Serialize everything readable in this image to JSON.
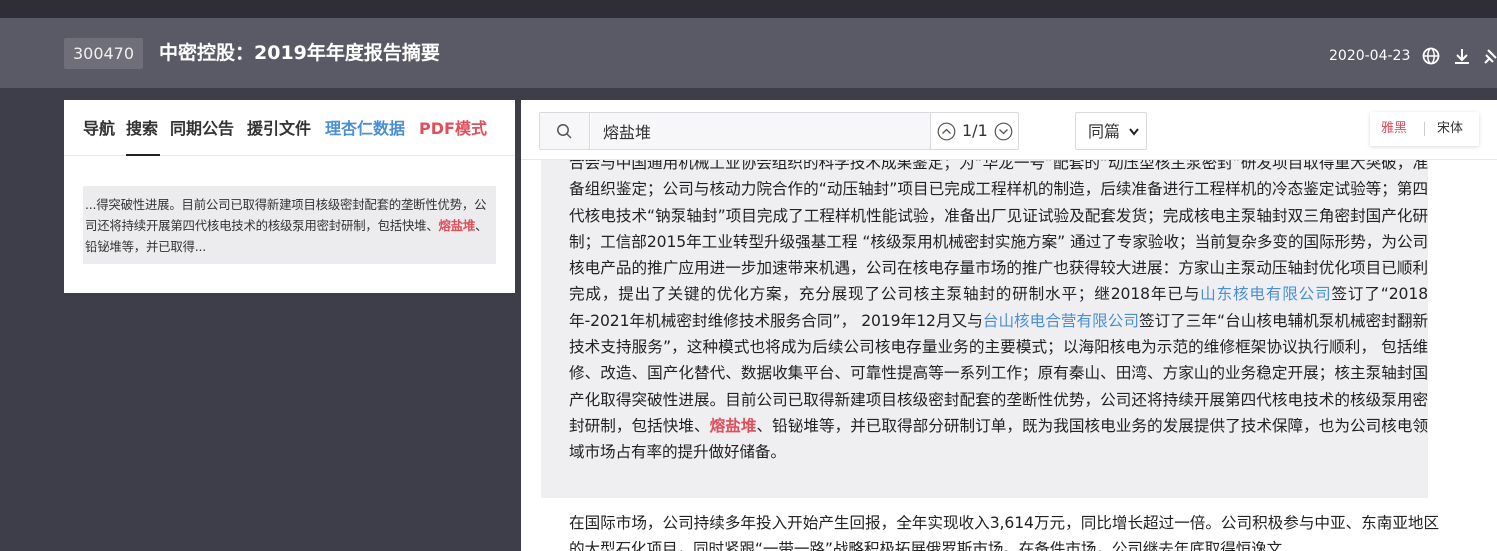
{
  "header": {
    "stock_code": "300470",
    "title": "中密控股：2019年年度报告摘要",
    "date": "2020-04-23",
    "icons": [
      "globe-icon",
      "download-icon",
      "pin-icon"
    ]
  },
  "nav": {
    "items": [
      "导航",
      "搜索",
      "同期公告",
      "援引文件",
      "理杏仁数据",
      "PDF模式"
    ],
    "active": "搜索",
    "colors": {
      "default": "#333333",
      "lixinger": "#4a8fd6",
      "pdf": "#e04f5c"
    }
  },
  "search_result": {
    "before": "...得突破性进展。目前公司已取得新建项目核级密封配套的垄断性优势，公司还将持续开展第四代核电技术的核级泵用密封研制，包括快堆、",
    "match": "熔盐堆",
    "after": "、铅铋堆等，并已取得..."
  },
  "toolbar": {
    "search_value": "熔盐堆",
    "match_count": "1/1",
    "scope": "同篇",
    "font_options": [
      "雅黑",
      "宋体"
    ],
    "font_active": "雅黑"
  },
  "document": {
    "p1_a": "合会与中国通用机械工业协会组织的科学技术成果鉴定；为“华龙一号”配套的“动压型核主泵密封”研发项目取得重大突破，准备组织鉴定；公司与核动力院合作的“动压轴封”项目已完成工程样机的制造，后续准备进行工程样机的冷态鉴定试验等；第四代核电技术“钠泵轴封”项目完成了工程样机性能试验，准备出厂见证试验及配套发货；完成核电主泵轴封双三角密封国产化研制；工信部2015年工业转型升级强基工程 “核级泵用机械密封实施方案” 通过了专家验收；当前复杂多变的国际形势，为公司核电产品的推广应用进一步加速带来机遇，公司在核电存量市场的推广也获得较大进展：方家山主泵动压轴封优化项目已顺利完成，提出了关键的优化方案，充分展现了公司核主泵轴封的研制水平；继2018年已与",
    "link1": "山东核电有限公司",
    "p1_b": "签订了“2018年-2021年机械密封维修技术服务合同”， 2019年12月又与",
    "link2": "台山核电合营有限公司",
    "p1_c": "签订了三年“台山核电辅机泵机械密封翻新技术支持服务”，这种模式也将成为后续公司核电存量业务的主要模式；以海阳核电为示范的维修框架协议执行顺利， 包括维修、改造、国产化替代、数据收集平台、可靠性提高等一系列工作；原有秦山、田湾、方家山的业务稳定开展；核主泵轴封国产化取得突破性进展。目前公司已取得新建项目核级密封配套的垄断性优势，公司还将持续开展第四代核电技术的核级泵用密封研制，包括快堆、",
    "match": "熔盐堆",
    "p1_d": "、铅铋堆等，并已取得部分研制订单，既为我国核电业务的发展提供了技术保障，也为公司核电领域市场占有率的提升做好储备。",
    "p2": "在国际市场，公司持续多年投入开始产生回报，全年实现收入3,614万元，同比增长超过一倍。公司积极参与中亚、东南亚地区的大型石化项目，同时紧跟“一带一路”战略积极拓展俄罗斯市场。在备件市场，公司继去年底取得恒逸文"
  }
}
